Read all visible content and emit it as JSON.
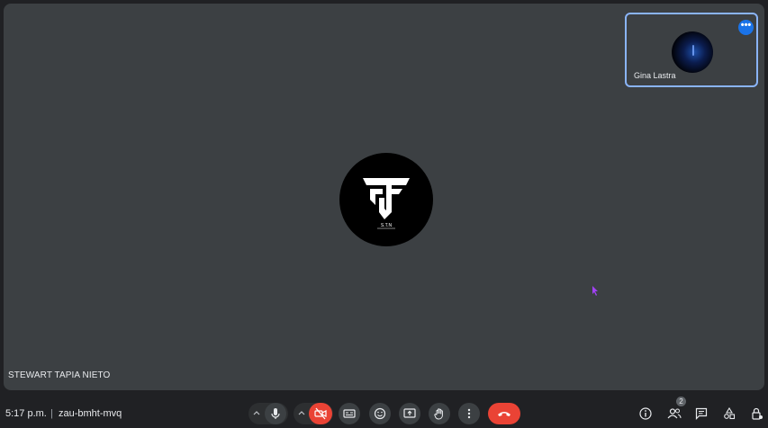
{
  "main_tile": {
    "participant_name": "STEWART TAPIA NIETO",
    "logo_text": "S.T.N"
  },
  "self_view": {
    "participant_name": "Gina Lastra",
    "more_label": "•••"
  },
  "bottom_bar": {
    "time": "5:17 p.m.",
    "separator": "|",
    "meeting_code": "zau-bmht-mvq",
    "participants_count": "2"
  },
  "colors": {
    "background": "#202124",
    "tile": "#3c4043",
    "end_call": "#ea4335",
    "accent": "#8ab4f8"
  },
  "icons": {
    "mic": "microphone-icon",
    "camera": "camera-off-icon",
    "captions": "captions-icon",
    "emoji": "emoji-icon",
    "present": "present-screen-icon",
    "hand": "raise-hand-icon",
    "more": "more-vert-icon",
    "end": "end-call-icon",
    "info": "info-icon",
    "people": "people-icon",
    "chat": "chat-icon",
    "activities": "activities-icon",
    "lock": "host-controls-icon"
  }
}
